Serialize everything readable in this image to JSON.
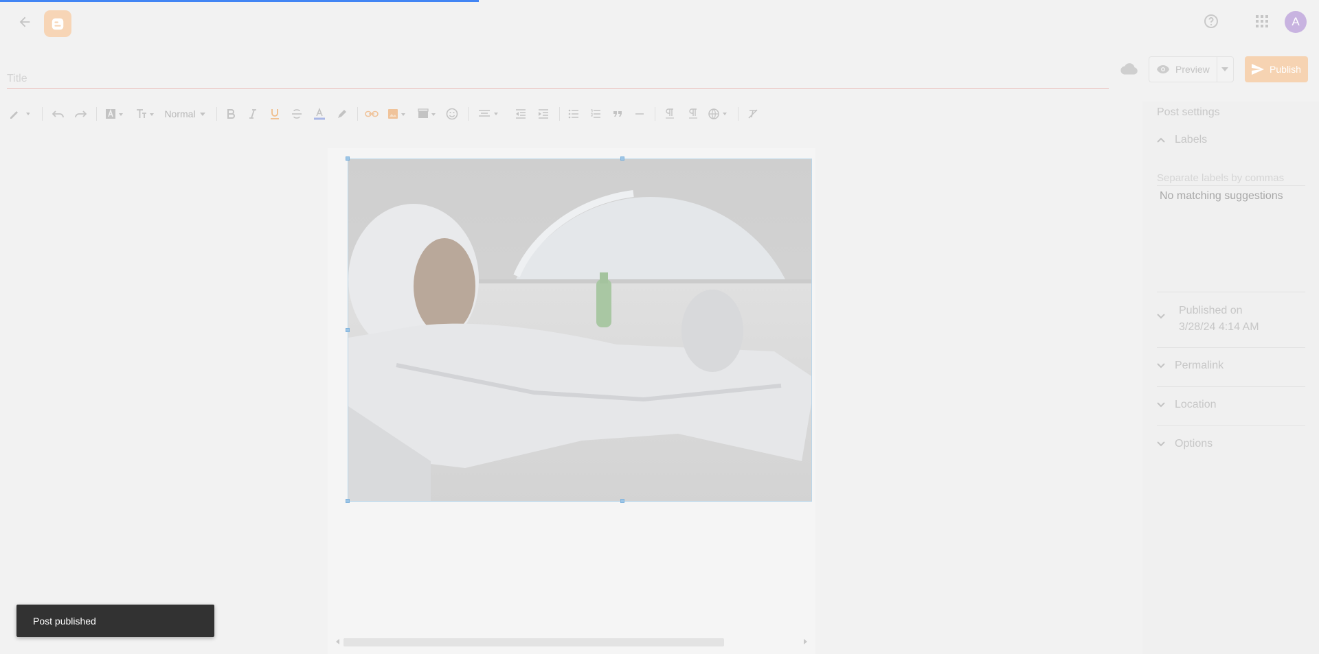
{
  "page": {
    "progress_fraction": 0.36
  },
  "header": {
    "back_icon": "arrow-back-icon",
    "logo_icon": "blogger-logo-icon",
    "help_icon": "help-circle-icon",
    "apps_icon": "apps-grid-icon",
    "avatar_letter": "A",
    "avatar_color": "#c8b3e0"
  },
  "editor": {
    "title_placeholder": "Title",
    "preview_label": "Preview",
    "publish_label": "Publish",
    "publish_color": "#f6d3b2",
    "toolbar": {
      "paragraph_style": "Normal"
    }
  },
  "settings": {
    "title": "Post settings",
    "sections": {
      "labels": "Labels",
      "labels_placeholder": "Separate labels by commas",
      "no_matching": "No matching suggestions",
      "published_on_label": "Published on",
      "published_on_value": "3/28/24 4:14 AM",
      "permalink": "Permalink",
      "location": "Location",
      "options": "Options"
    }
  },
  "snackbar": {
    "message": "Post published"
  }
}
